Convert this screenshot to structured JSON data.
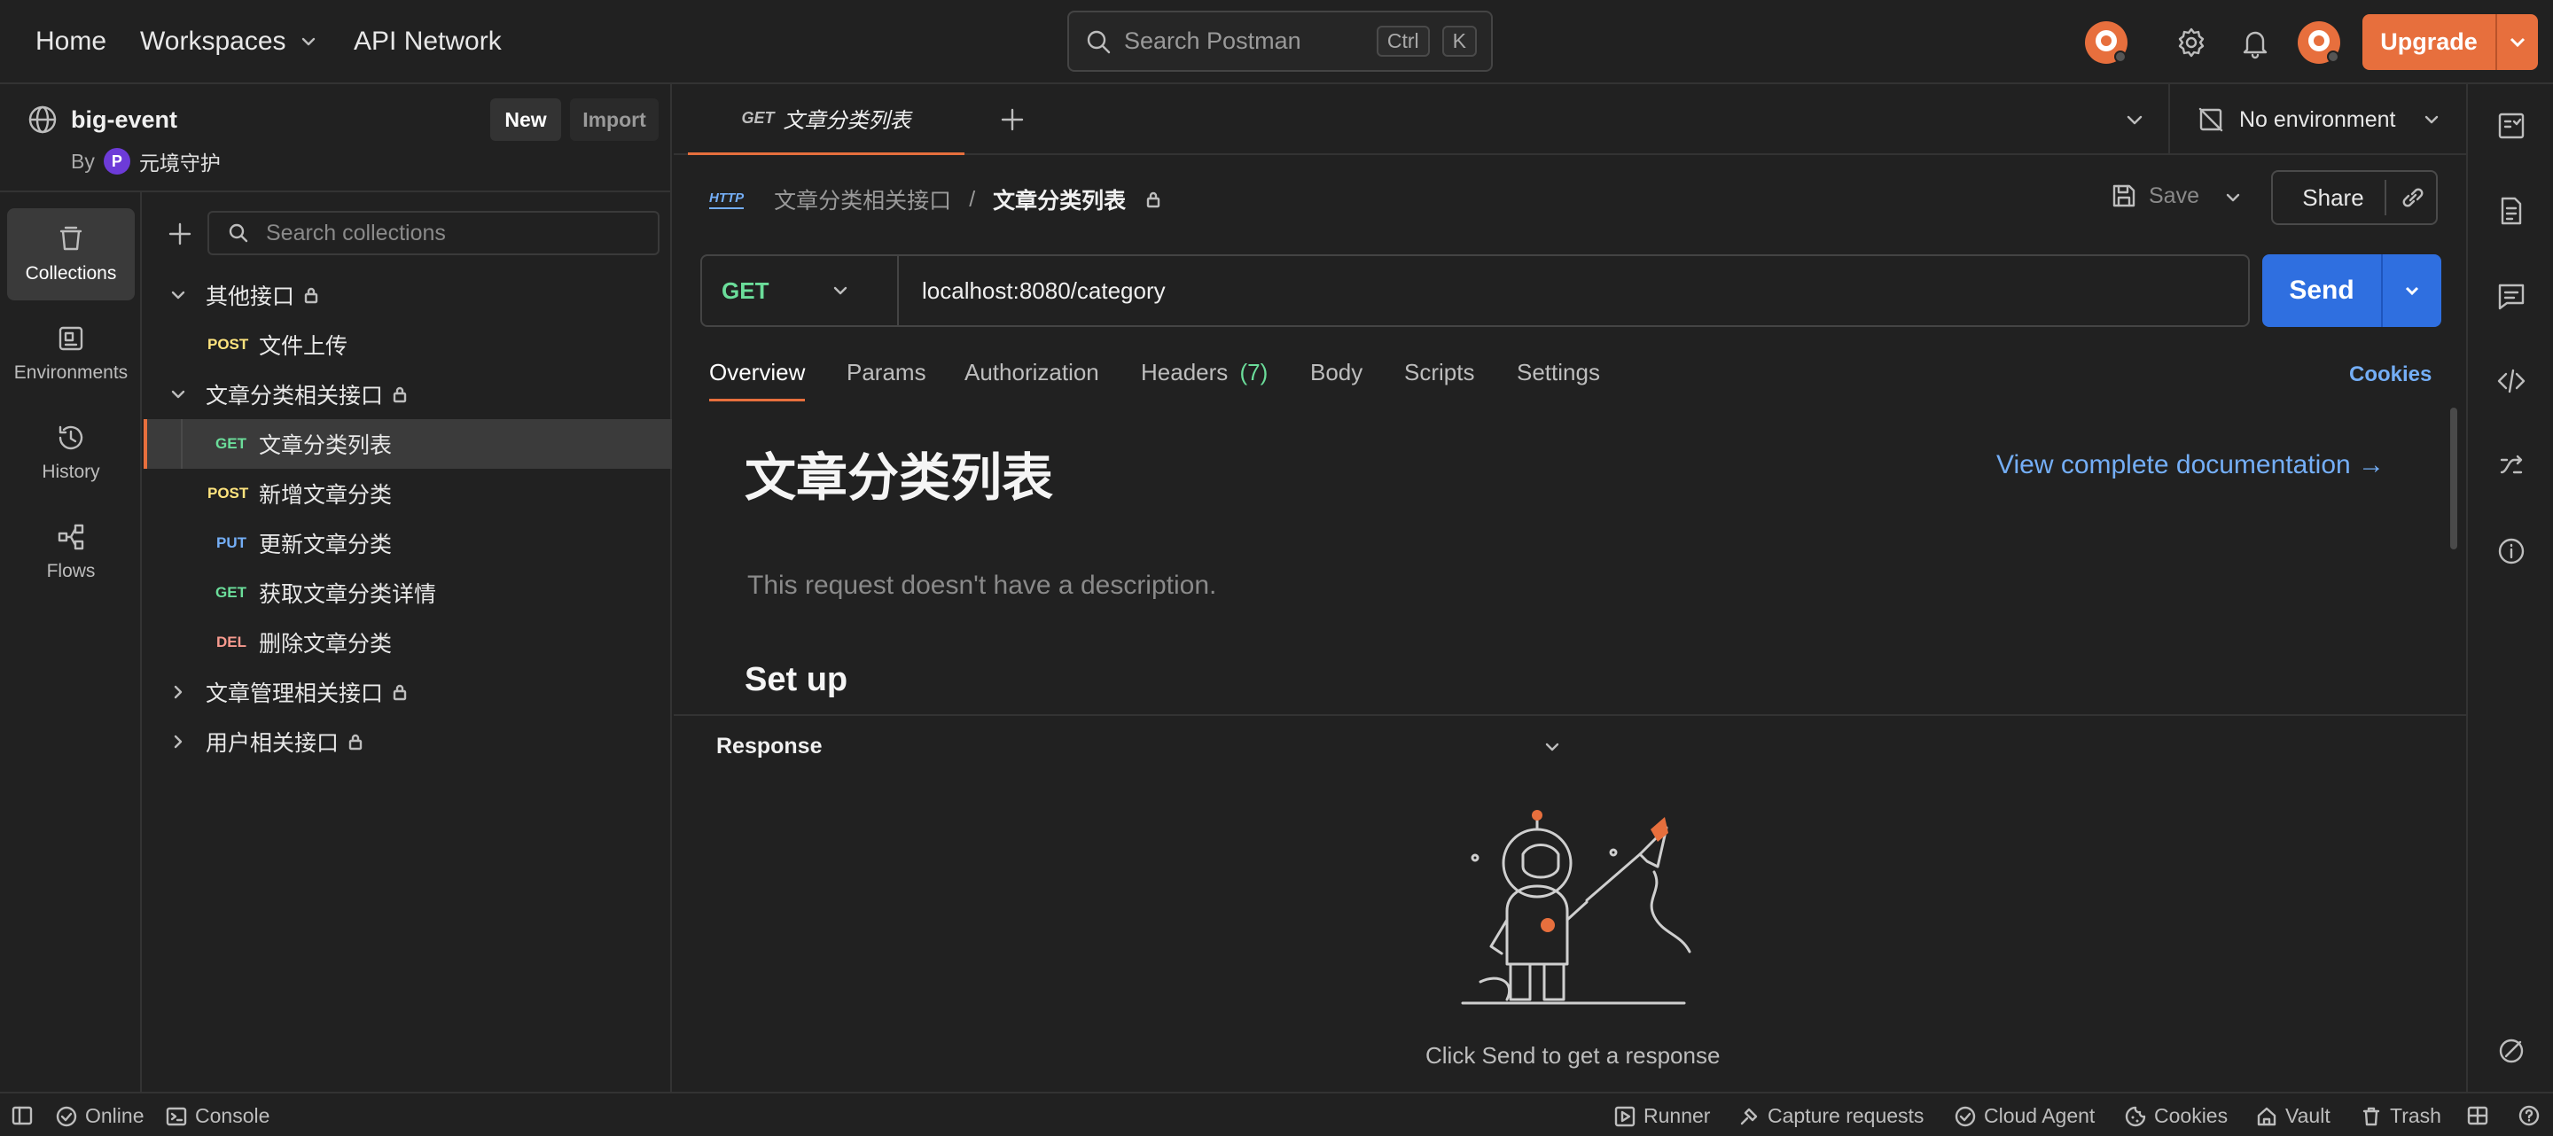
{
  "topbar": {
    "home": "Home",
    "workspaces": "Workspaces",
    "api_network": "API Network",
    "search_placeholder": "Search Postman",
    "kbd_ctrl": "Ctrl",
    "kbd_k": "K",
    "upgrade": "Upgrade"
  },
  "workspace": {
    "name": "big-event",
    "by": "By",
    "owner_initial": "P",
    "owner": "元境守护",
    "new_label": "New",
    "import_label": "Import"
  },
  "rail": {
    "collections": "Collections",
    "environments": "Environments",
    "history": "History",
    "flows": "Flows"
  },
  "sidebar": {
    "search_placeholder": "Search collections",
    "tree": [
      {
        "type": "folder",
        "label": "其他接口",
        "expanded": true
      },
      {
        "type": "request",
        "method": "POST",
        "label": "文件上传"
      },
      {
        "type": "folder",
        "label": "文章分类相关接口",
        "expanded": true
      },
      {
        "type": "request",
        "method": "GET",
        "label": "文章分类列表",
        "selected": true
      },
      {
        "type": "request",
        "method": "POST",
        "label": "新增文章分类"
      },
      {
        "type": "request",
        "method": "PUT",
        "label": "更新文章分类"
      },
      {
        "type": "request",
        "method": "GET",
        "label": "获取文章分类详情"
      },
      {
        "type": "request",
        "method": "DEL",
        "label": "删除文章分类"
      },
      {
        "type": "folder",
        "label": "文章管理相关接口",
        "expanded": false
      },
      {
        "type": "folder",
        "label": "用户相关接口",
        "expanded": false
      }
    ]
  },
  "tab": {
    "method": "GET",
    "label": "文章分类列表"
  },
  "environment": {
    "label": "No environment"
  },
  "breadcrumb": {
    "icon_text": "HTTP",
    "parent": "文章分类相关接口",
    "sep": "/",
    "current": "文章分类列表"
  },
  "actions": {
    "save": "Save",
    "share": "Share"
  },
  "request": {
    "method": "GET",
    "url": "localhost:8080/category",
    "send": "Send"
  },
  "request_tabs": {
    "overview": "Overview",
    "params": "Params",
    "authorization": "Authorization",
    "headers": "Headers",
    "headers_count": "(7)",
    "body": "Body",
    "scripts": "Scripts",
    "settings": "Settings",
    "cookies": "Cookies"
  },
  "overview": {
    "title": "文章分类列表",
    "doc_link": "View complete documentation →",
    "description": "This request doesn't have a description.",
    "setup": "Set up"
  },
  "response": {
    "title": "Response",
    "empty": "Click Send to get a response"
  },
  "statusbar": {
    "online": "Online",
    "console": "Console",
    "runner": "Runner",
    "capture": "Capture requests",
    "cloud_agent": "Cloud Agent",
    "cookies": "Cookies",
    "vault": "Vault",
    "trash": "Trash"
  },
  "colors": {
    "accent": "#e76f3d",
    "send": "#2f6fe0",
    "link": "#74aef6",
    "get": "#6bdd9a",
    "post": "#ffe47e",
    "put": "#74aef6",
    "del": "#f79a8e"
  }
}
